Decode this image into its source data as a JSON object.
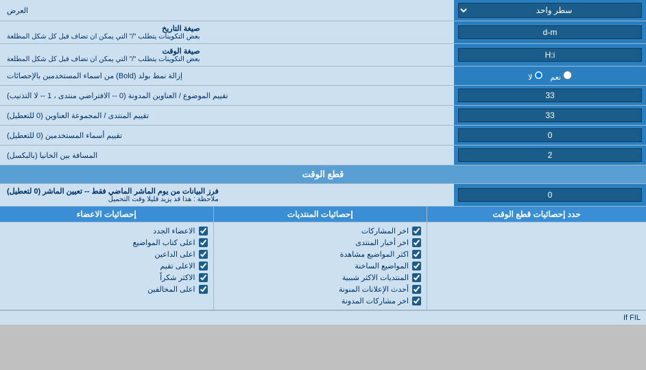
{
  "header": {
    "label_ard": "العرض",
    "dropdown_label": "سطر واحد"
  },
  "rows": [
    {
      "id": "date_format",
      "label": "صيغة التاريخ",
      "sublabel": "بعض التكوينات يتطلب \"/\" التي يمكن ان تضاف قبل كل شكل المطلعة",
      "input_value": "d-m",
      "input_type": "text"
    },
    {
      "id": "time_format",
      "label": "صيغة الوقت",
      "sublabel": "بعض التكوينات يتطلب \"/\" التي يمكن ان تضاف قبل كل شكل المطلعة",
      "input_value": "H:i",
      "input_type": "text"
    },
    {
      "id": "bold_remove",
      "label": "إزالة نمط بولد (Bold) من اسماء المستخدمين بالإحصائات",
      "input_type": "radio",
      "radio_options": [
        "نعم",
        "لا"
      ],
      "radio_selected": 1
    },
    {
      "id": "topic_sort",
      "label": "تقييم الموضوع / العناوين المدونة (0 -- الافتراضي منتدى ، 1 -- لا التذنيب)",
      "input_value": "33",
      "input_type": "text"
    },
    {
      "id": "forum_sort",
      "label": "تقييم المنتدى / المجموعة العناوين (0 للتعطيل)",
      "input_value": "33",
      "input_type": "text"
    },
    {
      "id": "username_sort",
      "label": "تقييم أسماء المستخدمين (0 للتعطيل)",
      "input_value": "0",
      "input_type": "text"
    },
    {
      "id": "distance",
      "label": "المسافة بين الخانيا (بالبكسل)",
      "input_value": "2",
      "input_type": "text"
    }
  ],
  "section_realtime": {
    "title": "قطع الوقت",
    "row": {
      "label": "فرز البيانات من يوم الماشر الماضي فقط -- تعيين الماشر (0 لتعطيل)",
      "sublabel": "ملاحظة : هذا قد يزيد قليلا وقت التحميل",
      "input_value": "0"
    }
  },
  "checkboxes_section": {
    "right_header": "حدد إحصائيات قطع الوقت",
    "col1_header": "إحصائيات المنتديات",
    "col2_header": "إحصائيات الاعضاء",
    "col1_items": [
      "اخر المشاركات",
      "اخر أخبار المنتدى",
      "اكثر المواضيع مشاهدة",
      "المواضيع الساخنة",
      "المنتديات الاكثر شببية",
      "أحدث الإعلانات المنونة",
      "اخر مشاركات المدونة"
    ],
    "col2_items": [
      "الاعضاء الجدد",
      "اعلى كتاب المواضيع",
      "اعلى الداعين",
      "الاعلى تقيم",
      "الاكثر شكراً",
      "اعلى المخالفين"
    ]
  },
  "bottom_text": "If FIL"
}
